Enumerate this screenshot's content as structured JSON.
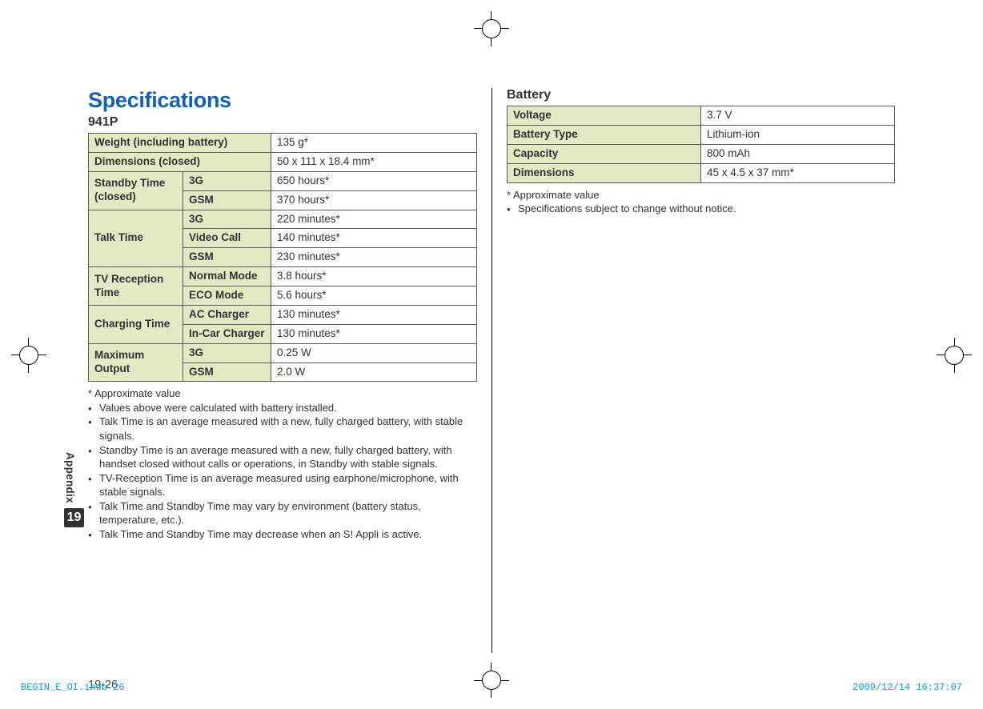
{
  "title": "Specifications",
  "model": "941P",
  "side": {
    "label": "Appendix",
    "chapter": "19"
  },
  "page_number": "19-26",
  "table941p": {
    "weight": {
      "label": "Weight (including battery)",
      "value": "135 g*"
    },
    "dim": {
      "label": "Dimensions (closed)",
      "value": "50 x 111 x 18.4 mm*"
    },
    "standby": {
      "label": "Standby Time (closed)",
      "r1": {
        "sub": "3G",
        "val": "650 hours*"
      },
      "r2": {
        "sub": "GSM",
        "val": "370 hours*"
      }
    },
    "talk": {
      "label": "Talk Time",
      "r1": {
        "sub": "3G",
        "val": "220 minutes*"
      },
      "r2": {
        "sub": "Video Call",
        "val": "140 minutes*"
      },
      "r3": {
        "sub": "GSM",
        "val": "230 minutes*"
      }
    },
    "tv": {
      "label": "TV Reception Time",
      "r1": {
        "sub": "Normal Mode",
        "val": "3.8 hours*"
      },
      "r2": {
        "sub": "ECO Mode",
        "val": "5.6 hours*"
      }
    },
    "charge": {
      "label": "Charging Time",
      "r1": {
        "sub": "AC Charger",
        "val": "130 minutes*"
      },
      "r2": {
        "sub": "In-Car Charger",
        "val": "130 minutes*"
      }
    },
    "output": {
      "label": "Maximum Output",
      "r1": {
        "sub": "3G",
        "val": "0.25 W"
      },
      "r2": {
        "sub": "GSM",
        "val": "2.0 W"
      }
    }
  },
  "notes941p": {
    "approx": "* Approximate value",
    "b1": "Values above were calculated with battery installed.",
    "b2": "Talk Time is an average measured with a new, fully charged battery, with stable signals.",
    "b3": "Standby Time is an average measured with a new, fully charged battery, with handset closed without calls or operations, in Standby with stable signals.",
    "b4": "TV-Reception Time is an average measured using earphone/microphone, with stable signals.",
    "b5": "Talk Time and Standby Time may vary by environment (battery status, temperature, etc.).",
    "b6": "Talk Time and Standby Time may decrease when an S! Appli is active."
  },
  "battery": {
    "heading": "Battery",
    "voltage": {
      "label": "Voltage",
      "value": "3.7 V"
    },
    "type": {
      "label": "Battery Type",
      "value": "Lithium-ion"
    },
    "capacity": {
      "label": "Capacity",
      "value": "800 mAh"
    },
    "dim": {
      "label": "Dimensions",
      "value": "45 x 4.5 x 37 mm*"
    }
  },
  "notesBattery": {
    "approx": "* Approximate value",
    "b1": "Specifications subject to change without notice."
  },
  "printmeta": {
    "file": "BEGIN_E_OI.indb   26",
    "stamp": "2009/12/14   16:37:07"
  }
}
